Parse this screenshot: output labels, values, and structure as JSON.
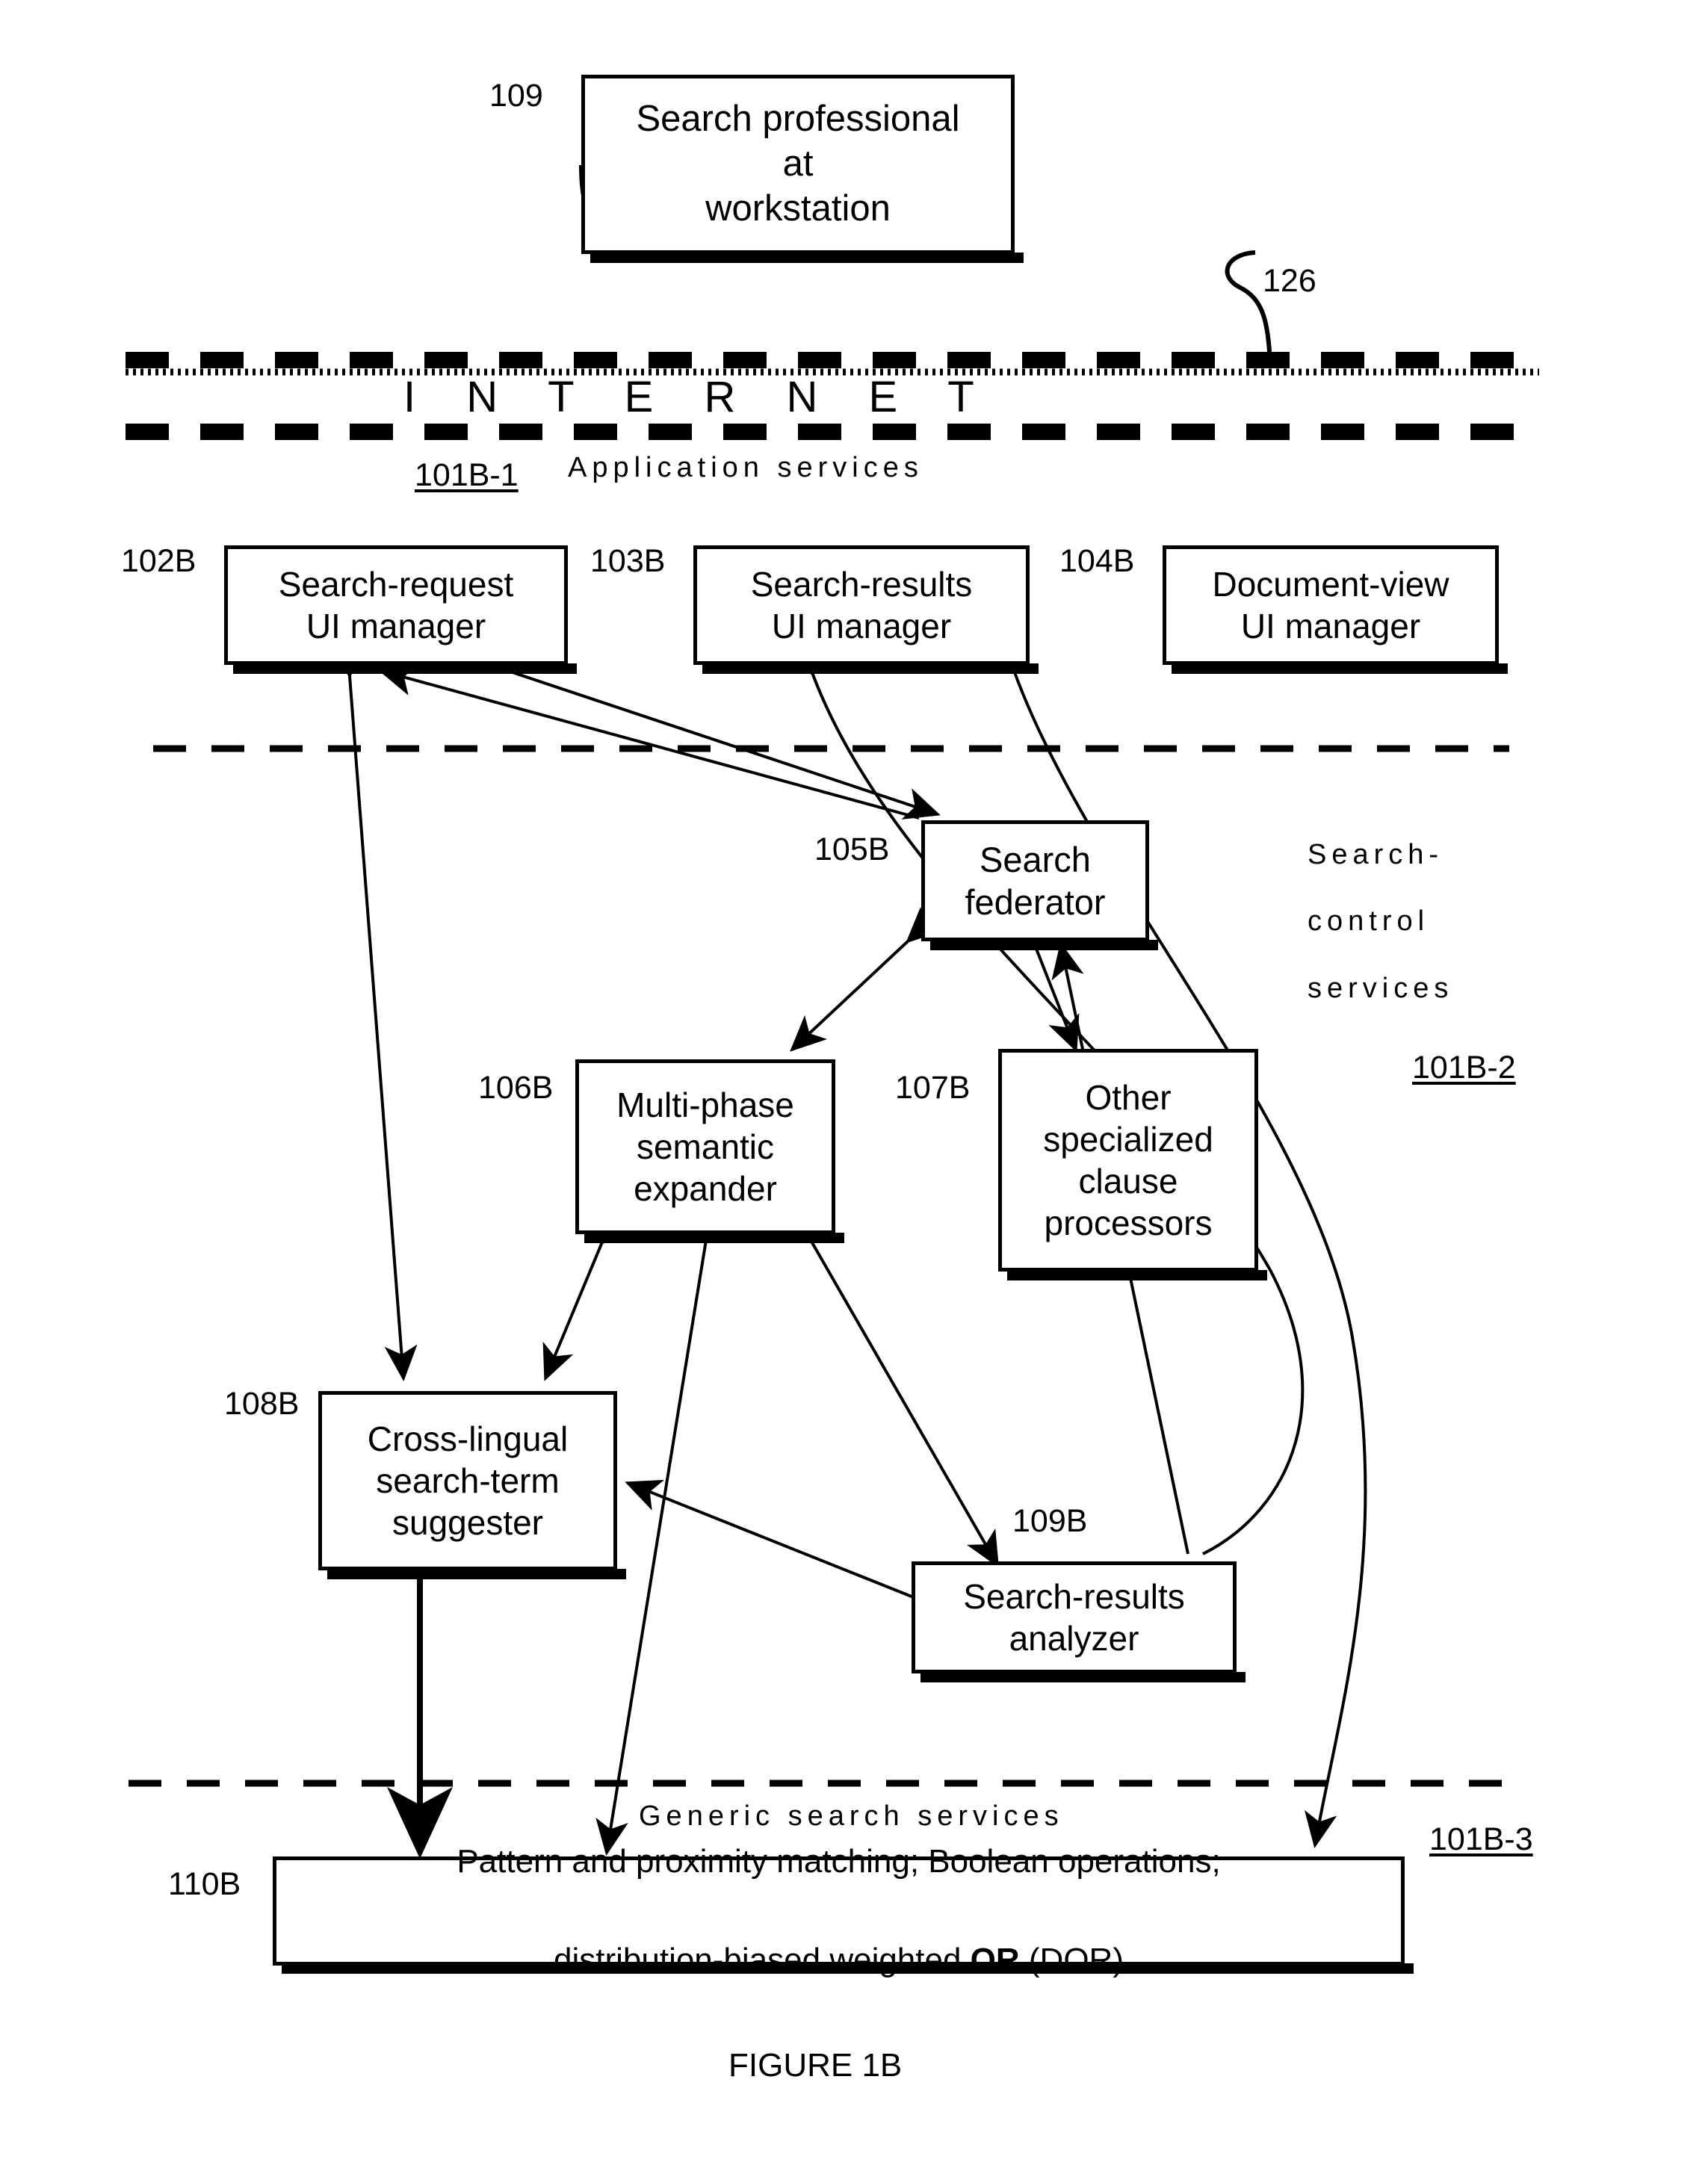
{
  "figure": {
    "caption": "FIGURE 1B",
    "internet_label": "I N T E R N E T",
    "internet_ref": "126"
  },
  "tiers": [
    {
      "ref": "101B-1",
      "label": "Application  services",
      "name": "application-services"
    },
    {
      "ref": "101B-2",
      "label": "Search-\ncontrol\nservices",
      "name": "search-control-services"
    },
    {
      "ref": "101B-3",
      "label": "Generic  search  services",
      "name": "generic-search-services"
    }
  ],
  "nodes": [
    {
      "ref": "109",
      "label": "Search professional\nat\nworkstation",
      "name": "search-professional-at-workstation"
    },
    {
      "ref": "102B",
      "label": "Search-request\nUI manager",
      "name": "search-request-ui-manager"
    },
    {
      "ref": "103B",
      "label": "Search-results\nUI manager",
      "name": "search-results-ui-manager"
    },
    {
      "ref": "104B",
      "label": "Document-view\nUI manager",
      "name": "document-view-ui-manager"
    },
    {
      "ref": "105B",
      "label": "Search\nfederator",
      "name": "search-federator"
    },
    {
      "ref": "106B",
      "label": "Multi-phase\nsemantic\nexpander",
      "name": "multi-phase-semantic-expander"
    },
    {
      "ref": "107B",
      "label": "Other\nspecialized\nclause\nprocessors",
      "name": "other-specialized-clause-processors"
    },
    {
      "ref": "108B",
      "label": "Cross-lingual\nsearch-term\nsuggester",
      "name": "cross-lingual-search-term-suggester"
    },
    {
      "ref": "109B",
      "label": "Search-results\nanalyzer",
      "name": "search-results-analyzer"
    },
    {
      "ref": "110B",
      "label": "",
      "name": "generic-search-engine",
      "line1": "Pattern and proximity matching;  Boolean operations;",
      "line2_a": "distribution-biased weighted ",
      "line2_b": "OR",
      "line2_c": "  (DOR)"
    }
  ],
  "colors": {
    "ink": "#000000",
    "paper": "#ffffff"
  }
}
